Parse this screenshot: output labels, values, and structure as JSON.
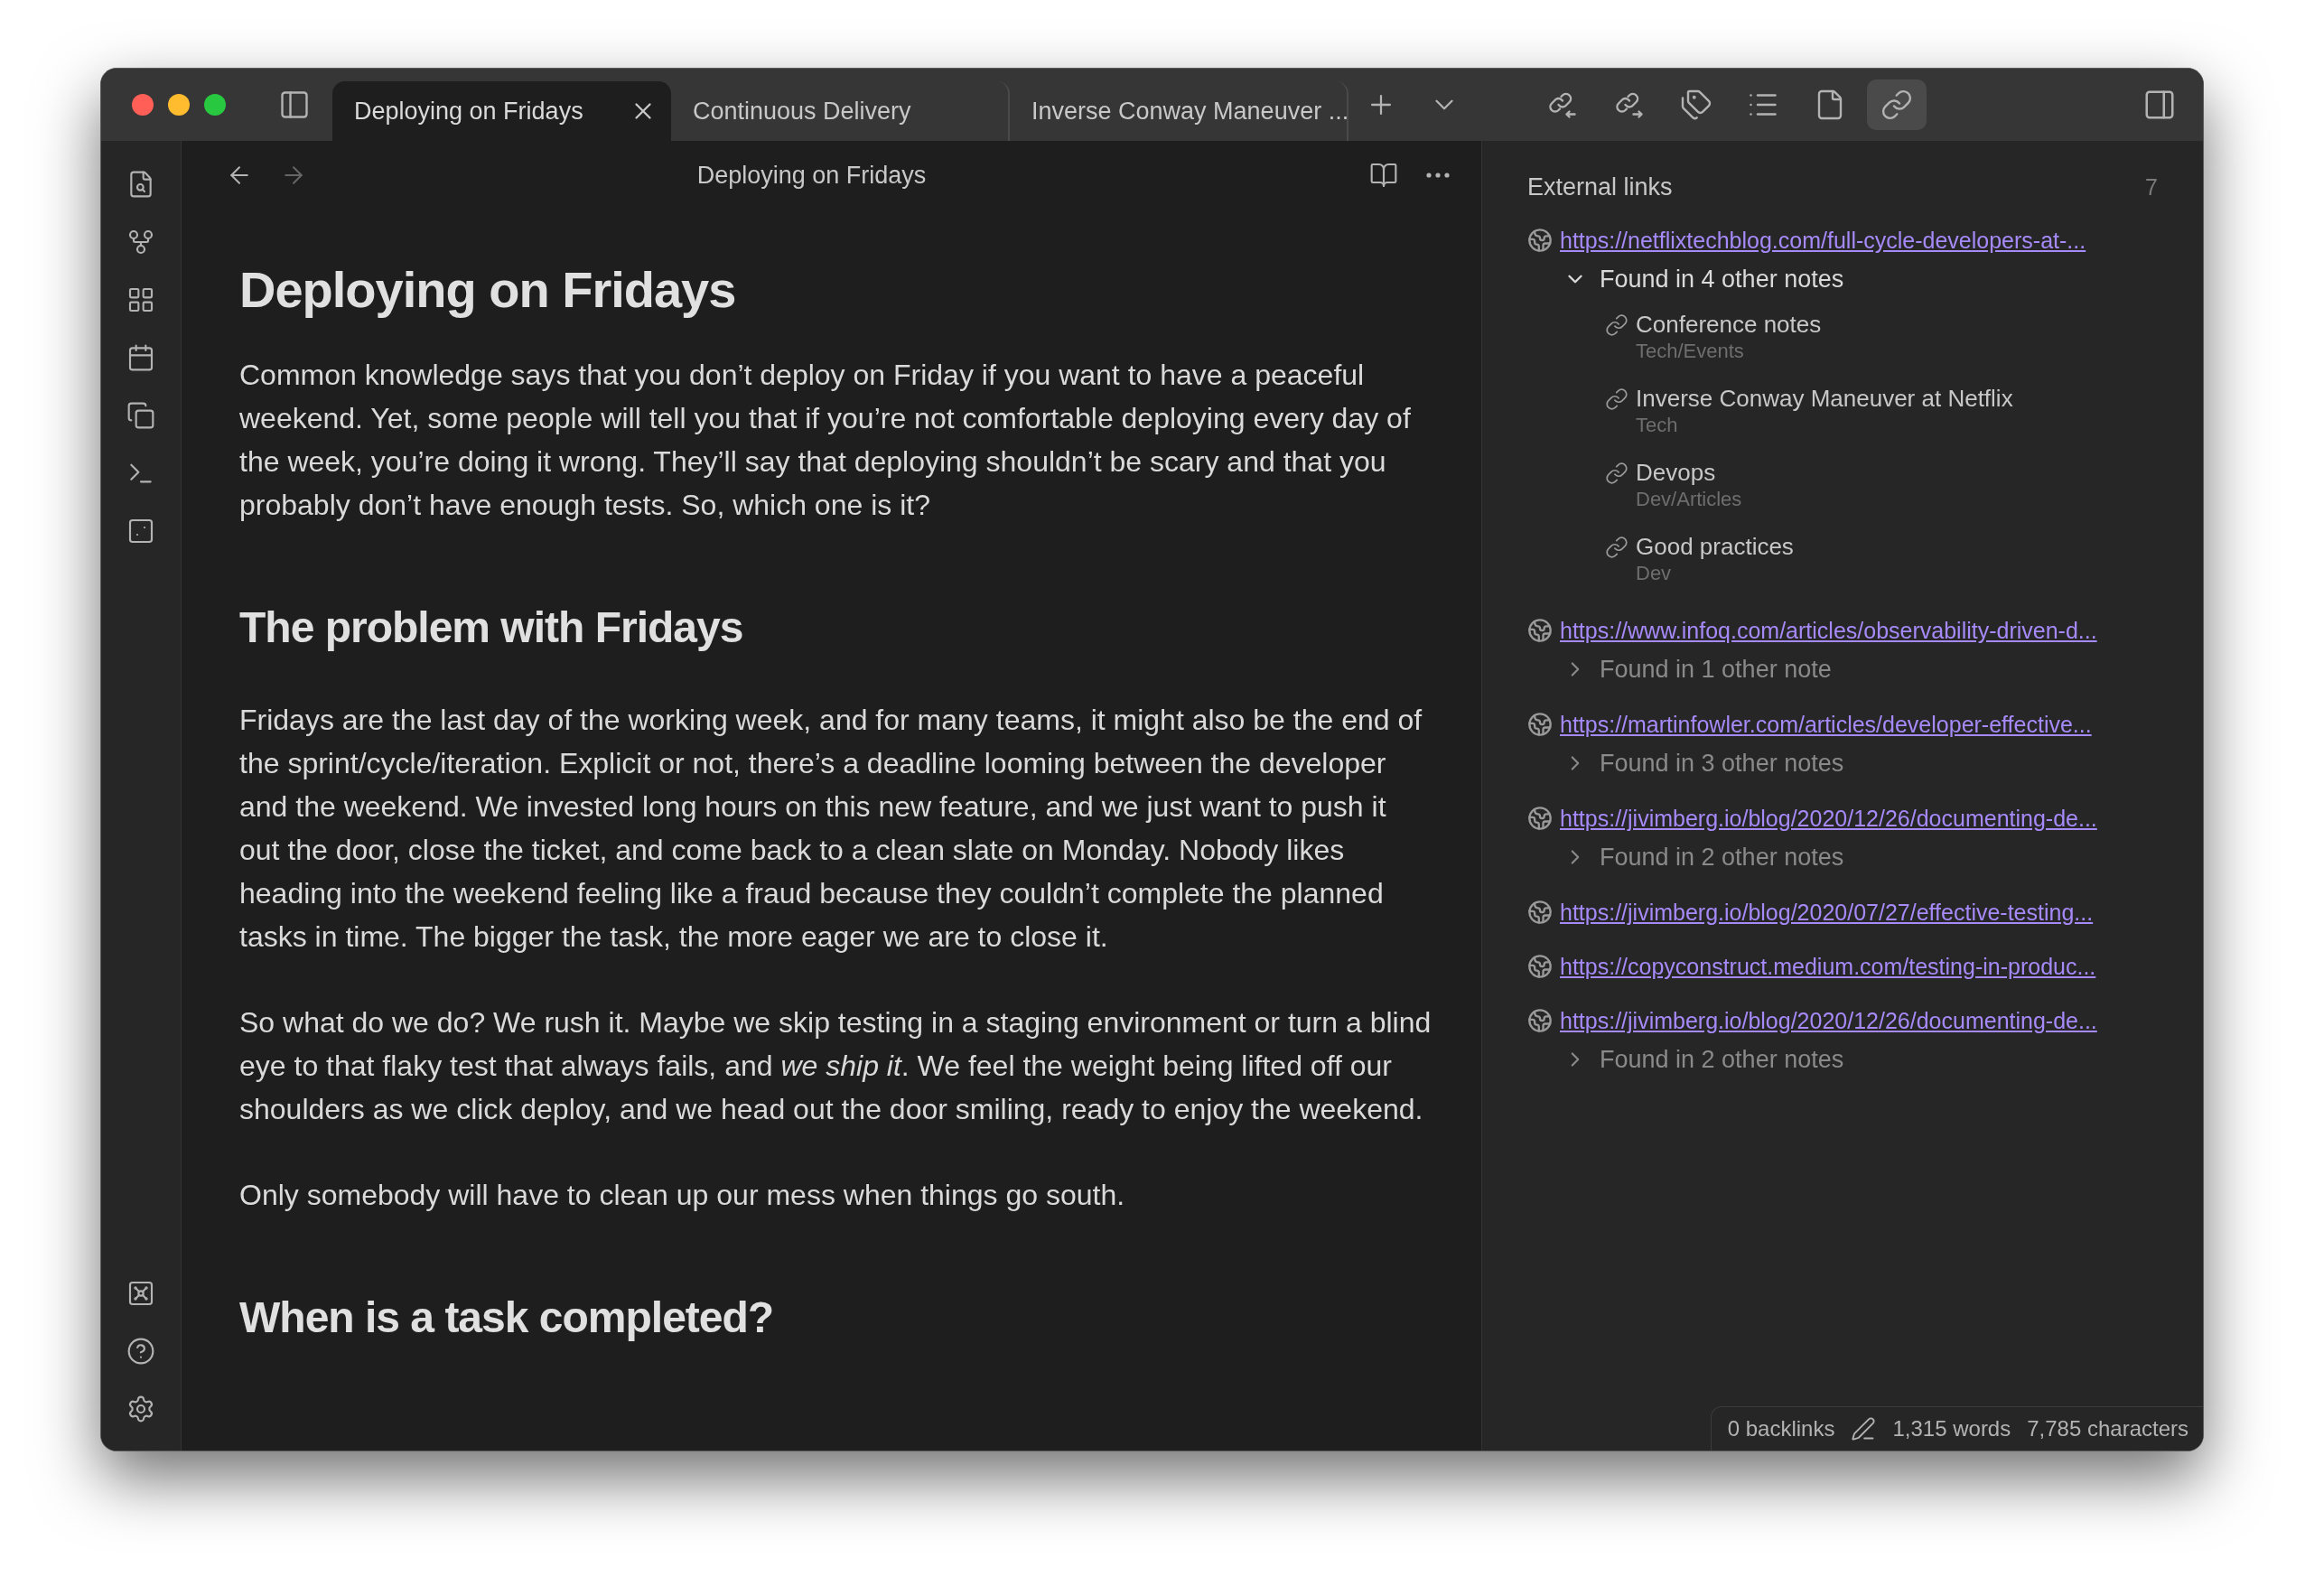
{
  "tabs": [
    {
      "label": "Deploying on Fridays",
      "selected": true
    },
    {
      "label": "Continuous Delivery",
      "selected": false
    },
    {
      "label": "Inverse Conway Maneuver ...",
      "selected": false
    }
  ],
  "side_toolbar": [
    {
      "kind": "backlinks",
      "selected": false
    },
    {
      "kind": "outgoing",
      "selected": false
    },
    {
      "kind": "tags",
      "selected": false
    },
    {
      "kind": "outline",
      "selected": false
    },
    {
      "kind": "properties",
      "selected": false
    },
    {
      "kind": "links",
      "selected": true
    }
  ],
  "editor": {
    "title": "Deploying on Fridays",
    "content": [
      {
        "kind": "h1",
        "text": "Deploying on Fridays"
      },
      {
        "kind": "p",
        "text": "Common knowledge says that you don’t deploy on Friday if you want to have a peaceful weekend. Yet, some people will tell you that if you’re not comfortable deploying every day of the week, you’re doing it wrong. They’ll say that deploying shouldn’t be scary and that you probably don’t have enough tests. So, which one is it?"
      },
      {
        "kind": "h2",
        "text": "The problem with Fridays"
      },
      {
        "kind": "p",
        "text": "Fridays are the last day of the working week, and for many teams, it might also be the end of the sprint/cycle/iteration. Explicit or not, there’s a deadline looming between the developer and the weekend. We invested long hours on this new feature, and we just want to push it out the door, close the ticket, and come back to a clean slate on Monday. Nobody likes heading into the weekend feeling like a fraud because they couldn’t complete the planned tasks in time. The bigger the task, the more eager we are to close it."
      },
      {
        "kind": "p",
        "text": "So what do we do? We rush it. Maybe we skip testing in a staging environment or turn a blind eye to that flaky test that always fails, and *we ship it*. We feel the weight being lifted off our shoulders as we click deploy, and we head out the door smiling, ready to enjoy the weekend."
      },
      {
        "kind": "p",
        "text": "Only somebody will have to clean up our mess when things go south."
      },
      {
        "kind": "h2",
        "text": "When is a task completed?"
      }
    ]
  },
  "right_panel": {
    "title": "External links",
    "count": "7",
    "links": [
      {
        "url": "https://netflixtechblog.com/full-cycle-developers-at-...",
        "found": {
          "label": "Found in 4 other notes",
          "expanded": true,
          "notes": [
            {
              "title": "Conference notes",
              "path": "Tech/Events"
            },
            {
              "title": "Inverse Conway Maneuver at Netflix",
              "path": "Tech"
            },
            {
              "title": "Devops",
              "path": "Dev/Articles"
            },
            {
              "title": "Good practices",
              "path": "Dev"
            }
          ]
        }
      },
      {
        "url": "https://www.infoq.com/articles/observability-driven-d...",
        "found": {
          "label": "Found in 1 other note",
          "expanded": false
        }
      },
      {
        "url": "https://martinfowler.com/articles/developer-effective...",
        "found": {
          "label": "Found in 3 other notes",
          "expanded": false
        }
      },
      {
        "url": "https://jivimberg.io/blog/2020/12/26/documenting-de...",
        "found": {
          "label": "Found in 2 other notes",
          "expanded": false
        }
      },
      {
        "url": "https://jivimberg.io/blog/2020/07/27/effective-testing..."
      },
      {
        "url": "https://copyconstruct.medium.com/testing-in-produc..."
      },
      {
        "url": "https://jivimberg.io/blog/2020/12/26/documenting-de...",
        "found": {
          "label": "Found in 2 other notes",
          "expanded": false
        }
      }
    ]
  },
  "status_bar": {
    "backlinks": "0 backlinks",
    "words": "1,315 words",
    "characters": "7,785 characters"
  }
}
